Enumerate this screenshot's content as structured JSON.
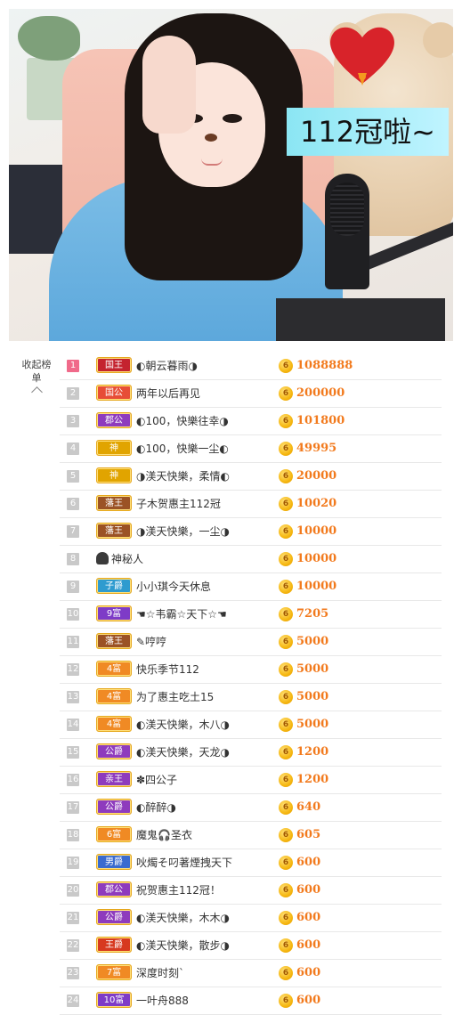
{
  "video": {
    "overlay_text": "112冠啦~",
    "accent_heart_color": "#d8232a",
    "overlay_bg": "#8be6f3"
  },
  "sidebar": {
    "collapse_label": "收起榜单",
    "collapse_icon": "chevron-up-icon"
  },
  "ranking": {
    "coin_icon": "coin-icon",
    "coin_glyph": "6",
    "rows": [
      {
        "rank": "1",
        "badge": "国王",
        "badge_color": "#c4232f",
        "name": "◐朝云暮雨◑",
        "amount": "1088888"
      },
      {
        "rank": "2",
        "badge": "国公",
        "badge_color": "#e74d37",
        "name": "两年以后再见",
        "amount": "200000"
      },
      {
        "rank": "3",
        "badge": "郡公",
        "badge_color": "#8e3bbd",
        "name": "◐100，快樂往幸◑",
        "amount": "101800"
      },
      {
        "rank": "4",
        "badge": "神",
        "badge_color": "#e1a400",
        "name": "◐100，快樂一尘◐",
        "amount": "49995"
      },
      {
        "rank": "5",
        "badge": "神",
        "badge_color": "#e1a400",
        "name": "◑渼天快樂，柔情◐",
        "amount": "20000"
      },
      {
        "rank": "6",
        "badge": "藩王",
        "badge_color": "#9b5225",
        "name": "子木贺惠主112冠",
        "amount": "10020"
      },
      {
        "rank": "7",
        "badge": "藩王",
        "badge_color": "#9b5225",
        "name": "◑渼天快樂，一尘◑",
        "amount": "10000"
      },
      {
        "rank": "8",
        "badge": "",
        "badge_color": "",
        "name": "神秘人",
        "amount": "10000"
      },
      {
        "rank": "9",
        "badge": "子爵",
        "badge_color": "#2e9bcf",
        "name": "小小琪今天休息",
        "amount": "10000"
      },
      {
        "rank": "10",
        "badge": "9富",
        "badge_color": "#7e3bc7",
        "name": "☚☆韦霸☆天下☆☚",
        "amount": "7205"
      },
      {
        "rank": "11",
        "badge": "藩王",
        "badge_color": "#9b5225",
        "name": "✎哼哼",
        "amount": "5000"
      },
      {
        "rank": "12",
        "badge": "4富",
        "badge_color": "#f08a24",
        "name": "快乐季节112",
        "amount": "5000"
      },
      {
        "rank": "13",
        "badge": "4富",
        "badge_color": "#f08a24",
        "name": "为了惠主吃土15",
        "amount": "5000"
      },
      {
        "rank": "14",
        "badge": "4富",
        "badge_color": "#f08a24",
        "name": "◐渼天快樂，木八◑",
        "amount": "5000"
      },
      {
        "rank": "15",
        "badge": "公爵",
        "badge_color": "#8e3bbd",
        "name": "◐渼天快樂，天龙◑",
        "amount": "1200"
      },
      {
        "rank": "16",
        "badge": "亲王",
        "badge_color": "#8e3bbd",
        "name": "✽四公子",
        "amount": "1200"
      },
      {
        "rank": "17",
        "badge": "公爵",
        "badge_color": "#8e3bbd",
        "name": "◐醉醉◑",
        "amount": "640"
      },
      {
        "rank": "18",
        "badge": "6富",
        "badge_color": "#f08a24",
        "name": "魔鬼🎧圣衣",
        "amount": "605"
      },
      {
        "rank": "19",
        "badge": "男爵",
        "badge_color": "#3a6bcf",
        "name": "吙燭そ叼著煙拽天下",
        "amount": "600"
      },
      {
        "rank": "20",
        "badge": "郡公",
        "badge_color": "#8e3bbd",
        "name": "祝贺惠主112冠！",
        "amount": "600"
      },
      {
        "rank": "21",
        "badge": "公爵",
        "badge_color": "#8e3bbd",
        "name": "◐渼天快樂，木木◑",
        "amount": "600"
      },
      {
        "rank": "22",
        "badge": "王爵",
        "badge_color": "#d7391f",
        "name": "◐渼天快樂，散步◑",
        "amount": "600"
      },
      {
        "rank": "23",
        "badge": "7富",
        "badge_color": "#f08a24",
        "name": "深度时刻`",
        "amount": "600"
      },
      {
        "rank": "24",
        "badge": "10富",
        "badge_color": "#7e3bc7",
        "name": "一叶舟888",
        "amount": "600"
      }
    ]
  }
}
